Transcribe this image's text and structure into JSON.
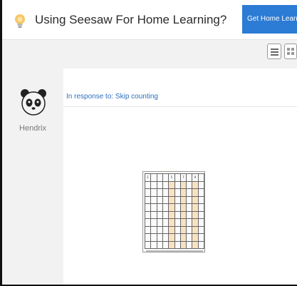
{
  "topbar": {
    "title": "Using Seesaw For Home Learning?",
    "home_button_label": "Get Home Learning Code",
    "icon": "lightbulb-icon"
  },
  "toolbar": {
    "list_view_icon": "list-view-icon",
    "grid_view_icon": "grid-view-icon"
  },
  "sidebar": {
    "author_name": "Hendrix",
    "avatar_icon": "panda-avatar-icon"
  },
  "post": {
    "response_label": "In response to: Skip counting",
    "attachment": {
      "type": "hundreds-chart-image",
      "cells": [
        "1",
        "",
        "",
        "",
        "5",
        "",
        "7",
        "",
        "9",
        ""
      ]
    }
  }
}
